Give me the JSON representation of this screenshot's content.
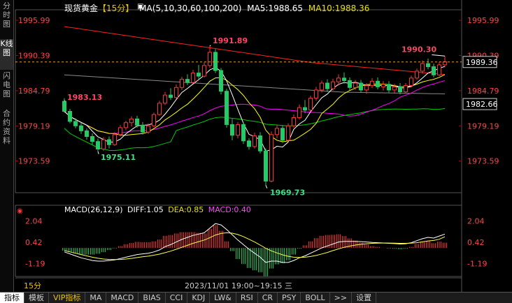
{
  "side_tabs": [
    "分时图",
    "K线图",
    "闪电图",
    "合约资料"
  ],
  "header": {
    "name": "现货黄金",
    "period": "【15分】",
    "ma_title": "MA(5,10,30,60,100,200)",
    "ma5": "MA5:1988.65",
    "ma10": "MA10:1988.36"
  },
  "price_axis": [
    "1995.99",
    "1990.39",
    "1984.79",
    "1979.19",
    "1973.59"
  ],
  "price_tags": {
    "current": "1989.36",
    "secondary": "1982.66"
  },
  "annotations": {
    "high_left": "1991.89",
    "low": "1969.73",
    "start": "1983.13",
    "mid_low": "1975.11",
    "high_right": "1990.30"
  },
  "macd": {
    "title": "MACD(26,12,9)",
    "diff": "DIFF:1.05",
    "dea": "DEA:0.85",
    "macd": "MACD:0.40",
    "axis": [
      "2.04",
      "0.42",
      "-1.19"
    ]
  },
  "time_bar": {
    "period": "15分",
    "time": "2023/11/01 19:00~19:15 三"
  },
  "bottom_tabs": [
    "指标",
    "模板",
    "VIP指标",
    "MA",
    "MACD",
    "BIAS",
    "CCI",
    "KDJ",
    "LW&",
    "RSI",
    "CR",
    "PSY",
    "BOLL",
    ">>",
    "设置"
  ],
  "colors": {
    "up": "#ff3333",
    "down": "#22cc66",
    "ma5": "#ffffff",
    "ma10": "#ffff00",
    "ma30": "#ff00ff",
    "ma60": "#00cc00",
    "ma100": "#ff2020",
    "ma200": "#888888",
    "dea": "#ffff44"
  },
  "chart_data": {
    "type": "candlestick",
    "ylim": [
      1969.0,
      1997.0
    ],
    "candles": [
      [
        1983.1,
        1983.6,
        1981.3,
        1981.5
      ],
      [
        1981.5,
        1981.9,
        1979.6,
        1979.9
      ],
      [
        1979.9,
        1980.4,
        1978.8,
        1979.2
      ],
      [
        1979.2,
        1979.7,
        1977.9,
        1978.4
      ],
      [
        1978.4,
        1978.8,
        1977.0,
        1977.5
      ],
      [
        1977.5,
        1978.0,
        1976.2,
        1976.7
      ],
      [
        1976.7,
        1977.2,
        1975.1,
        1975.5
      ],
      [
        1975.5,
        1977.4,
        1975.2,
        1977.0
      ],
      [
        1977.0,
        1977.5,
        1975.6,
        1976.2
      ],
      [
        1976.2,
        1978.2,
        1976.0,
        1977.8
      ],
      [
        1977.8,
        1979.3,
        1977.5,
        1978.9
      ],
      [
        1978.9,
        1980.0,
        1978.5,
        1979.7
      ],
      [
        1979.7,
        1980.7,
        1979.1,
        1980.3
      ],
      [
        1980.3,
        1980.8,
        1978.9,
        1979.3
      ],
      [
        1979.3,
        1979.8,
        1977.8,
        1978.2
      ],
      [
        1978.2,
        1979.6,
        1977.9,
        1979.2
      ],
      [
        1979.2,
        1981.3,
        1979.0,
        1981.0
      ],
      [
        1981.0,
        1983.2,
        1980.8,
        1982.8
      ],
      [
        1982.8,
        1984.6,
        1982.5,
        1984.1
      ],
      [
        1984.1,
        1985.2,
        1983.3,
        1983.7
      ],
      [
        1983.7,
        1985.8,
        1983.5,
        1985.3
      ],
      [
        1985.3,
        1987.0,
        1984.9,
        1986.6
      ],
      [
        1986.6,
        1987.4,
        1985.7,
        1986.1
      ],
      [
        1986.1,
        1988.1,
        1985.9,
        1987.6
      ],
      [
        1987.6,
        1988.9,
        1986.7,
        1987.1
      ],
      [
        1987.1,
        1989.3,
        1986.9,
        1988.8
      ],
      [
        1988.8,
        1991.9,
        1988.4,
        1990.9
      ],
      [
        1990.9,
        1991.4,
        1987.6,
        1988.0
      ],
      [
        1988.0,
        1988.4,
        1984.2,
        1984.7
      ],
      [
        1984.7,
        1985.1,
        1978.9,
        1979.4
      ],
      [
        1979.4,
        1980.3,
        1976.9,
        1977.7
      ],
      [
        1977.7,
        1979.8,
        1977.2,
        1979.4
      ],
      [
        1979.4,
        1979.8,
        1976.3,
        1976.8
      ],
      [
        1976.8,
        1977.2,
        1975.4,
        1975.9
      ],
      [
        1975.9,
        1978.1,
        1975.6,
        1977.6
      ],
      [
        1977.6,
        1978.2,
        1974.8,
        1975.2
      ],
      [
        1975.2,
        1975.6,
        1969.7,
        1970.4
      ],
      [
        1970.4,
        1978.3,
        1970.2,
        1977.8
      ],
      [
        1977.8,
        1979.4,
        1977.2,
        1978.8
      ],
      [
        1978.8,
        1979.3,
        1976.5,
        1976.9
      ],
      [
        1976.9,
        1979.6,
        1976.7,
        1979.2
      ],
      [
        1979.2,
        1981.0,
        1978.9,
        1980.5
      ],
      [
        1980.5,
        1982.6,
        1980.2,
        1982.1
      ],
      [
        1982.1,
        1983.3,
        1981.2,
        1981.7
      ],
      [
        1981.7,
        1984.0,
        1981.5,
        1983.6
      ],
      [
        1983.6,
        1985.4,
        1983.2,
        1984.9
      ],
      [
        1984.9,
        1986.4,
        1984.5,
        1986.0
      ],
      [
        1986.0,
        1986.6,
        1984.6,
        1985.1
      ],
      [
        1985.1,
        1986.7,
        1984.8,
        1986.2
      ],
      [
        1986.2,
        1987.4,
        1985.6,
        1986.8
      ],
      [
        1986.8,
        1987.7,
        1985.9,
        1986.4
      ],
      [
        1986.4,
        1986.9,
        1984.9,
        1985.3
      ],
      [
        1985.3,
        1986.5,
        1984.9,
        1986.0
      ],
      [
        1986.0,
        1986.5,
        1984.5,
        1984.9
      ],
      [
        1984.9,
        1986.0,
        1984.3,
        1985.6
      ],
      [
        1985.6,
        1986.8,
        1985.2,
        1986.3
      ],
      [
        1986.3,
        1986.9,
        1985.0,
        1985.4
      ],
      [
        1985.4,
        1986.3,
        1984.8,
        1985.8
      ],
      [
        1985.8,
        1986.3,
        1984.5,
        1984.9
      ],
      [
        1984.9,
        1985.9,
        1984.3,
        1985.4
      ],
      [
        1985.4,
        1986.0,
        1984.2,
        1984.6
      ],
      [
        1984.6,
        1986.0,
        1984.3,
        1985.6
      ],
      [
        1985.6,
        1987.2,
        1985.3,
        1986.8
      ],
      [
        1986.8,
        1988.3,
        1986.5,
        1987.9
      ],
      [
        1987.9,
        1989.6,
        1987.5,
        1989.1
      ],
      [
        1989.1,
        1989.9,
        1988.2,
        1988.6
      ],
      [
        1988.6,
        1989.1,
        1986.9,
        1987.3
      ],
      [
        1987.3,
        1989.4,
        1987.1,
        1988.9
      ],
      [
        1988.9,
        1990.3,
        1988.5,
        1989.4
      ]
    ],
    "macd_diff": [
      -0.3,
      -0.45,
      -0.6,
      -0.75,
      -0.85,
      -0.95,
      -1.0,
      -1.0,
      -0.95,
      -0.9,
      -0.8,
      -0.7,
      -0.6,
      -0.5,
      -0.45,
      -0.4,
      -0.3,
      -0.15,
      0.1,
      0.25,
      0.45,
      0.65,
      0.8,
      0.95,
      1.05,
      1.15,
      1.5,
      1.85,
      1.75,
      1.4,
      1.0,
      0.6,
      0.25,
      -0.1,
      -0.4,
      -0.7,
      -1.1,
      -1.0,
      -1.0,
      -1.1,
      -1.1,
      -0.95,
      -0.75,
      -0.6,
      -0.4,
      -0.2,
      0.0,
      0.15,
      0.3,
      0.45,
      0.5,
      0.5,
      0.5,
      0.48,
      0.45,
      0.42,
      0.4,
      0.38,
      0.35,
      0.33,
      0.3,
      0.32,
      0.4,
      0.55,
      0.7,
      0.8,
      0.75,
      0.9,
      1.05
    ],
    "macd_dea": [
      -0.2,
      -0.3,
      -0.4,
      -0.5,
      -0.6,
      -0.7,
      -0.78,
      -0.84,
      -0.87,
      -0.88,
      -0.87,
      -0.84,
      -0.79,
      -0.73,
      -0.67,
      -0.62,
      -0.55,
      -0.47,
      -0.36,
      -0.24,
      -0.1,
      0.05,
      0.2,
      0.35,
      0.48,
      0.6,
      0.78,
      0.98,
      1.1,
      1.15,
      1.12,
      1.02,
      0.86,
      0.66,
      0.45,
      0.22,
      -0.03,
      -0.22,
      -0.38,
      -0.52,
      -0.63,
      -0.7,
      -0.72,
      -0.7,
      -0.65,
      -0.57,
      -0.46,
      -0.34,
      -0.2,
      -0.07,
      0.05,
      0.14,
      0.22,
      0.28,
      0.32,
      0.35,
      0.36,
      0.37,
      0.37,
      0.36,
      0.35,
      0.35,
      0.36,
      0.4,
      0.46,
      0.53,
      0.57,
      0.66,
      0.85
    ],
    "macd_range": [
      -1.95,
      2.6
    ]
  }
}
